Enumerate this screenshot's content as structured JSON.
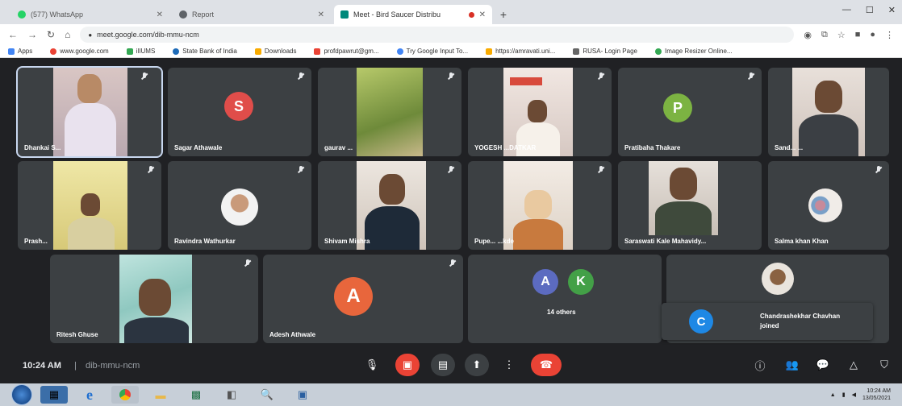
{
  "browser": {
    "tabs": [
      {
        "title": "(577) WhatsApp",
        "color": "#25d366"
      },
      {
        "title": "Report",
        "color": "#5f6368"
      },
      {
        "title": "Meet - Bird Saucer Distribu",
        "color": "#00897b",
        "active": true
      }
    ],
    "new_tab_symbol": "+",
    "url": "meet.google.com/dib-mmu-ncm",
    "bookmarks": [
      {
        "label": "Apps",
        "color": "#4285f4"
      },
      {
        "label": "www.google.com",
        "color": "#ea4335"
      },
      {
        "label": "ilIUMS",
        "color": "#34a853"
      },
      {
        "label": "State Bank of India",
        "color": "#1e6bb8"
      },
      {
        "label": "Downloads",
        "color": "#f9ab00"
      },
      {
        "label": "profdpawrut@gm...",
        "color": "#ea4335"
      },
      {
        "label": "Try Google Input To...",
        "color": "#4285f4"
      },
      {
        "label": "https://amravati.uni...",
        "color": "#f9ab00"
      },
      {
        "label": "RUSA- Login Page",
        "color": "#666666"
      },
      {
        "label": "Image Resizer Online...",
        "color": "#34a853"
      }
    ]
  },
  "meet": {
    "participants": [
      {
        "name": "Dhankai S...",
        "kind": "video"
      },
      {
        "name": "Sagar Athawale",
        "kind": "avatar",
        "initial": "S",
        "color": "#e04d4a"
      },
      {
        "name": "gaurav ...",
        "kind": "video"
      },
      {
        "name": "YOGESH ...DATKAR",
        "kind": "video"
      },
      {
        "name": "Pratibaha Thakare",
        "kind": "avatar",
        "initial": "P",
        "color": "#7cb342"
      },
      {
        "name": "Sand... ...",
        "kind": "video"
      },
      {
        "name": "Prash...",
        "kind": "video"
      },
      {
        "name": "Ravindra Wathurkar",
        "kind": "photo"
      },
      {
        "name": "Shivam Mishra",
        "kind": "video"
      },
      {
        "name": "Pupe... ...kde",
        "kind": "video"
      },
      {
        "name": "Saraswati Kale Mahavidy...",
        "kind": "video"
      },
      {
        "name": "Salma khan Khan",
        "kind": "photo"
      },
      {
        "name": "Ritesh Ghuse",
        "kind": "video"
      },
      {
        "name": "Adesh Athwale",
        "kind": "avatar",
        "initial": "A",
        "color": "#e8663c"
      }
    ],
    "others": {
      "label": "14 others",
      "avatars": [
        {
          "initial": "A",
          "color": "#5c6bc0"
        },
        {
          "initial": "K",
          "color": "#43a047"
        }
      ]
    },
    "notification": {
      "initial": "C",
      "color": "#1e88e5",
      "name": "Chandrashekhar Chavhan",
      "action": "joined"
    },
    "time": "10:24 AM",
    "divider": "|",
    "meeting_code": "dib-mmu-ncm"
  },
  "taskbar": {
    "time": "10:24 AM",
    "date": "13/05/2021"
  },
  "colors": {
    "meet_bg": "#202124",
    "tile_bg": "#3c4043",
    "end_call": "#ea4335",
    "mic_off": "#ea4335"
  }
}
